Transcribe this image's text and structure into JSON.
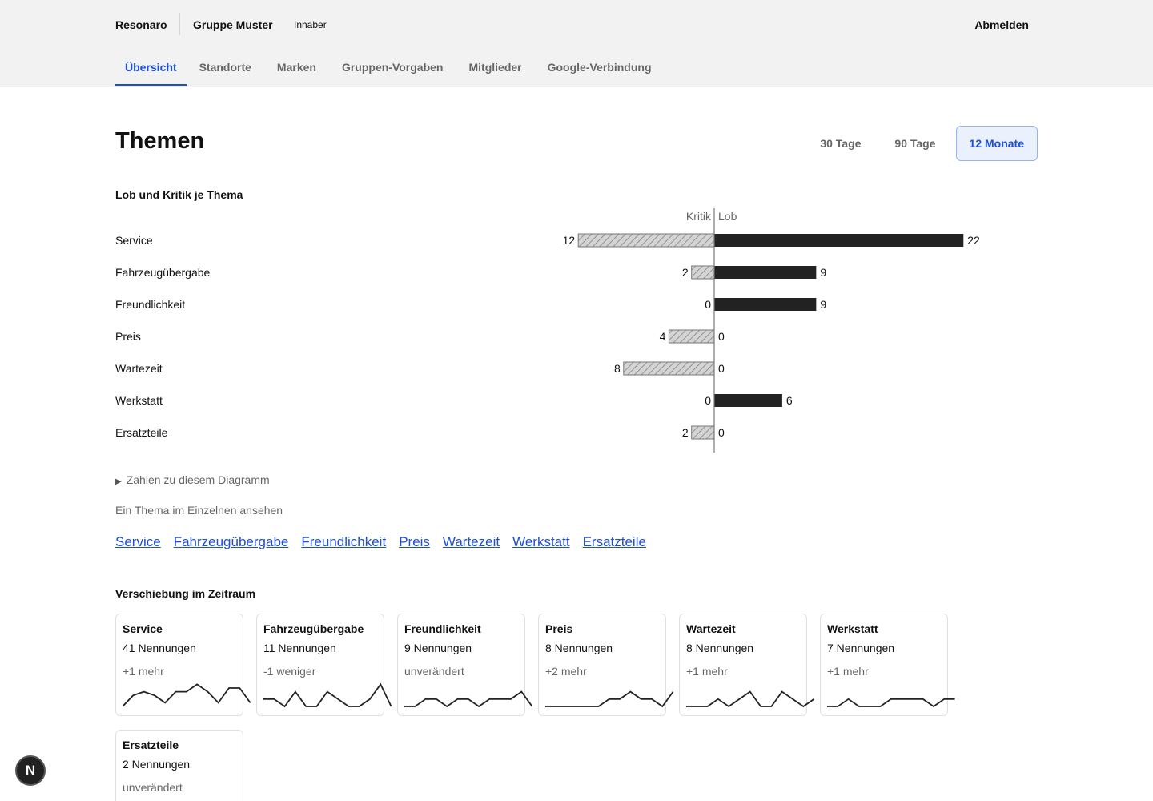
{
  "header": {
    "brand": "Resonaro",
    "group": "Gruppe Muster",
    "role": "Inhaber",
    "logout": "Abmelden"
  },
  "tabs": [
    {
      "label": "Übersicht",
      "active": true
    },
    {
      "label": "Standorte"
    },
    {
      "label": "Marken"
    },
    {
      "label": "Gruppen-Vorgaben"
    },
    {
      "label": "Mitglieder"
    },
    {
      "label": "Google-Verbindung"
    }
  ],
  "page": {
    "title": "Themen",
    "ranges": [
      {
        "label": "30 Tage"
      },
      {
        "label": "90 Tage"
      },
      {
        "label": "12 Monate",
        "active": true
      }
    ]
  },
  "chart_section": {
    "heading": "Lob und Kritik je Thema",
    "details_label": "Zahlen zu diesem Diagramm",
    "hint": "Ein Thema im Einzelnen ansehen"
  },
  "chart_data": {
    "type": "bar",
    "categories": [
      "Service",
      "Fahrzeugübergabe",
      "Freundlichkeit",
      "Preis",
      "Wartezeit",
      "Werkstatt",
      "Ersatzteile"
    ],
    "series": [
      {
        "name": "Kritik",
        "values": [
          12,
          2,
          0,
          4,
          8,
          0,
          2
        ]
      },
      {
        "name": "Lob",
        "values": [
          22,
          9,
          9,
          0,
          0,
          6,
          0
        ]
      }
    ],
    "colors": {
      "Kritik": "#d4d4d4",
      "Lob": "#222222"
    }
  },
  "topic_links": [
    "Service",
    "Fahrzeugübergabe",
    "Freundlichkeit",
    "Preis",
    "Wartezeit",
    "Werkstatt",
    "Ersatzteile"
  ],
  "shift_section": {
    "heading": "Verschiebung im Zeitraum",
    "cards": [
      {
        "name": "Service",
        "count": "41 Nennungen",
        "delta": "+1 mehr",
        "spark": [
          0,
          3,
          4,
          3,
          1,
          4,
          4,
          6,
          4,
          1,
          5,
          5,
          1
        ]
      },
      {
        "name": "Fahrzeugübergabe",
        "count": "11 Nennungen",
        "delta": "-1 weniger",
        "spark": [
          2,
          2,
          0,
          4,
          0,
          0,
          4,
          2,
          0,
          0,
          2,
          6,
          0
        ]
      },
      {
        "name": "Freundlichkeit",
        "count": "9 Nennungen",
        "delta": "unverändert",
        "spark": [
          0,
          0,
          2,
          2,
          0,
          2,
          2,
          0,
          2,
          2,
          2,
          4,
          0
        ]
      },
      {
        "name": "Preis",
        "count": "8 Nennungen",
        "delta": "+2 mehr",
        "spark": [
          0,
          0,
          0,
          0,
          0,
          0,
          2,
          2,
          4,
          2,
          2,
          0,
          4
        ]
      },
      {
        "name": "Wartezeit",
        "count": "8 Nennungen",
        "delta": "+1 mehr",
        "spark": [
          0,
          0,
          0,
          2,
          0,
          2,
          4,
          0,
          0,
          4,
          2,
          0,
          2
        ]
      },
      {
        "name": "Werkstatt",
        "count": "7 Nennungen",
        "delta": "+1 mehr",
        "spark": [
          0,
          0,
          2,
          0,
          0,
          0,
          2,
          2,
          2,
          2,
          0,
          2,
          2
        ]
      },
      {
        "name": "Ersatzteile",
        "count": "2 Nennungen",
        "delta": "unverändert",
        "spark": [
          0,
          0,
          0,
          0,
          0,
          0,
          0,
          2,
          0,
          0,
          0,
          0,
          0
        ]
      }
    ]
  },
  "badge": "N"
}
